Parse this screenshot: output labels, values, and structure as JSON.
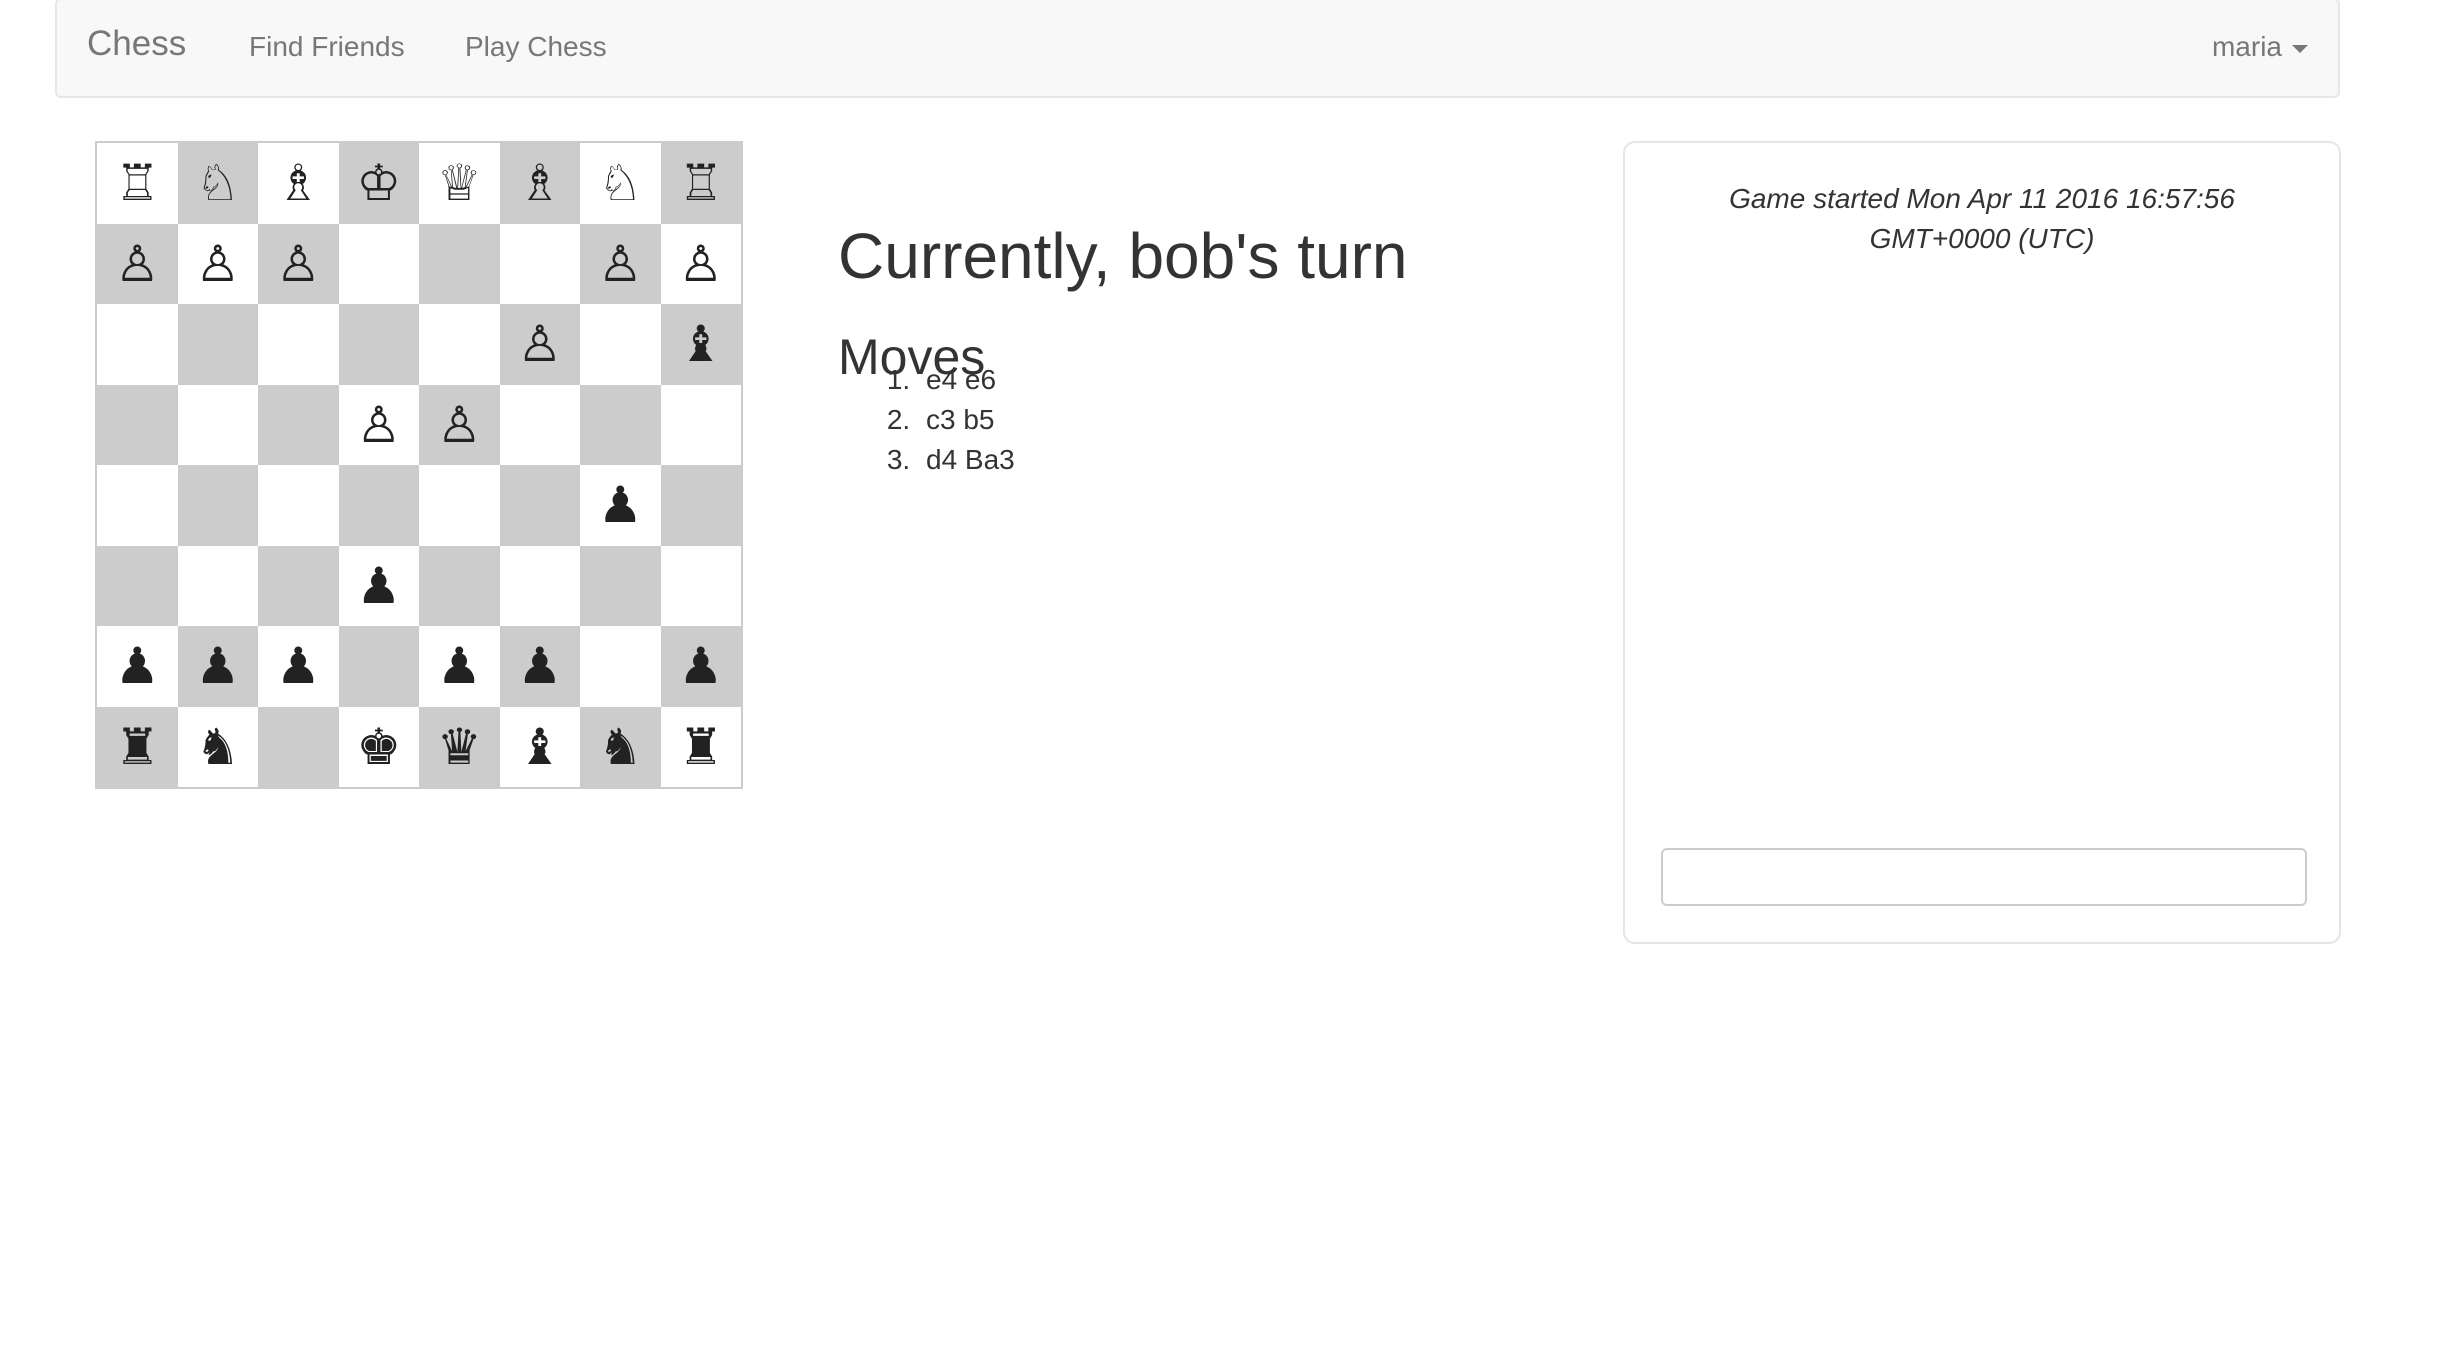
{
  "navbar": {
    "brand": "Chess",
    "links": [
      "Find Friends",
      "Play Chess"
    ],
    "user": "maria"
  },
  "board": {
    "rows": [
      [
        "♖",
        "♘",
        "♗",
        "♔",
        "♕",
        "♗",
        "♘",
        "♖"
      ],
      [
        "♙",
        "♙",
        "♙",
        "",
        "",
        "",
        "♙",
        "♙"
      ],
      [
        "",
        "",
        "",
        "",
        "",
        "♙",
        "",
        "♝"
      ],
      [
        "",
        "",
        "",
        "♙",
        "♙",
        "",
        "",
        ""
      ],
      [
        "",
        "",
        "",
        "",
        "",
        "",
        "♟",
        ""
      ],
      [
        "",
        "",
        "",
        "♟",
        "",
        "",
        "",
        ""
      ],
      [
        "♟",
        "♟",
        "♟",
        "",
        "♟",
        "♟",
        "",
        "♟"
      ],
      [
        "♜",
        "♞",
        "",
        "♚",
        "♛",
        "♝",
        "♞",
        "♜"
      ]
    ]
  },
  "status": "Currently, bob's turn",
  "moves": {
    "heading": "Moves",
    "list": [
      "e4 e6",
      "c3 b5",
      "d4 Ba3"
    ]
  },
  "chat": {
    "log": "Game started Mon Apr 11 2016 16:57:56 GMT+0000 (UTC)",
    "input_value": ""
  }
}
